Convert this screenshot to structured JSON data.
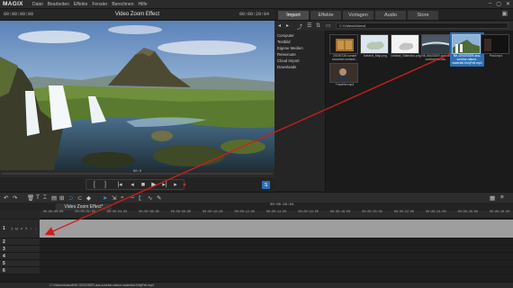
{
  "app": {
    "logo": "MAGIX",
    "menu": [
      "Datei",
      "Bearbeiten",
      "Effekte",
      "Fenster",
      "Berechnen",
      "Hilfe"
    ]
  },
  "preview": {
    "timecode_left": "00:00:00:00",
    "title": "Video Zoom Effect",
    "timecode_right": "00:00:29:04",
    "position_timecode": "00:0"
  },
  "pool": {
    "tabs": [
      "Import",
      "Effekte",
      "Vorlagen",
      "Audio",
      "Store"
    ],
    "active_tab": "Import",
    "path": "C:\\Videos\\Island",
    "tree": [
      "Computer",
      "Testbild",
      "Eigene Medien",
      "Reiseroute",
      "Cloud Import",
      "Downloads"
    ],
    "files": [
      {
        "name": "20190728 sunset mountain iceland..."
      },
      {
        "name": "Iceland_Map.png"
      },
      {
        "name": "Iceland_Statistics.png"
      },
      {
        "name": "NK-WASSER-iceland-continental-wa..."
      },
      {
        "name": "NK-GROSSER-aus-sunrise-nature-waterfall-KirkjFell.mp4"
      },
      {
        "name": "Paul.mp4"
      },
      {
        "name": "Traveller.mp4"
      }
    ]
  },
  "timeline": {
    "arrangement_tab": "Video Zoom Effect*",
    "timecode": "00:00:29:04",
    "ruler_ticks": [
      "00:00:00:00",
      "00:00:02:00",
      "00:00:04:00",
      "00:00:06:00",
      "00:00:08:00",
      "00:00:10:00",
      "00:00:12:00",
      "00:00:14:00",
      "00:00:16:00",
      "00:00:18:00",
      "00:00:20:00",
      "00:00:22:00",
      "00:00:24:00",
      "00:00:26:00",
      "00:00:28:00"
    ],
    "tracks": [
      "1",
      "2",
      "3",
      "4",
      "5",
      "6"
    ],
    "track1_controls": "S M ⚭ ✎ ↕ ⋮"
  },
  "status": {
    "text": "C:\\Videos\\Island\\NK-GROSSER-aus-sunrise-nature-waterfall-KirkjFell.mp4"
  },
  "colors": {
    "accent": "#2e6fb5",
    "arrow": "#d01d1d",
    "record": "#d02020"
  }
}
